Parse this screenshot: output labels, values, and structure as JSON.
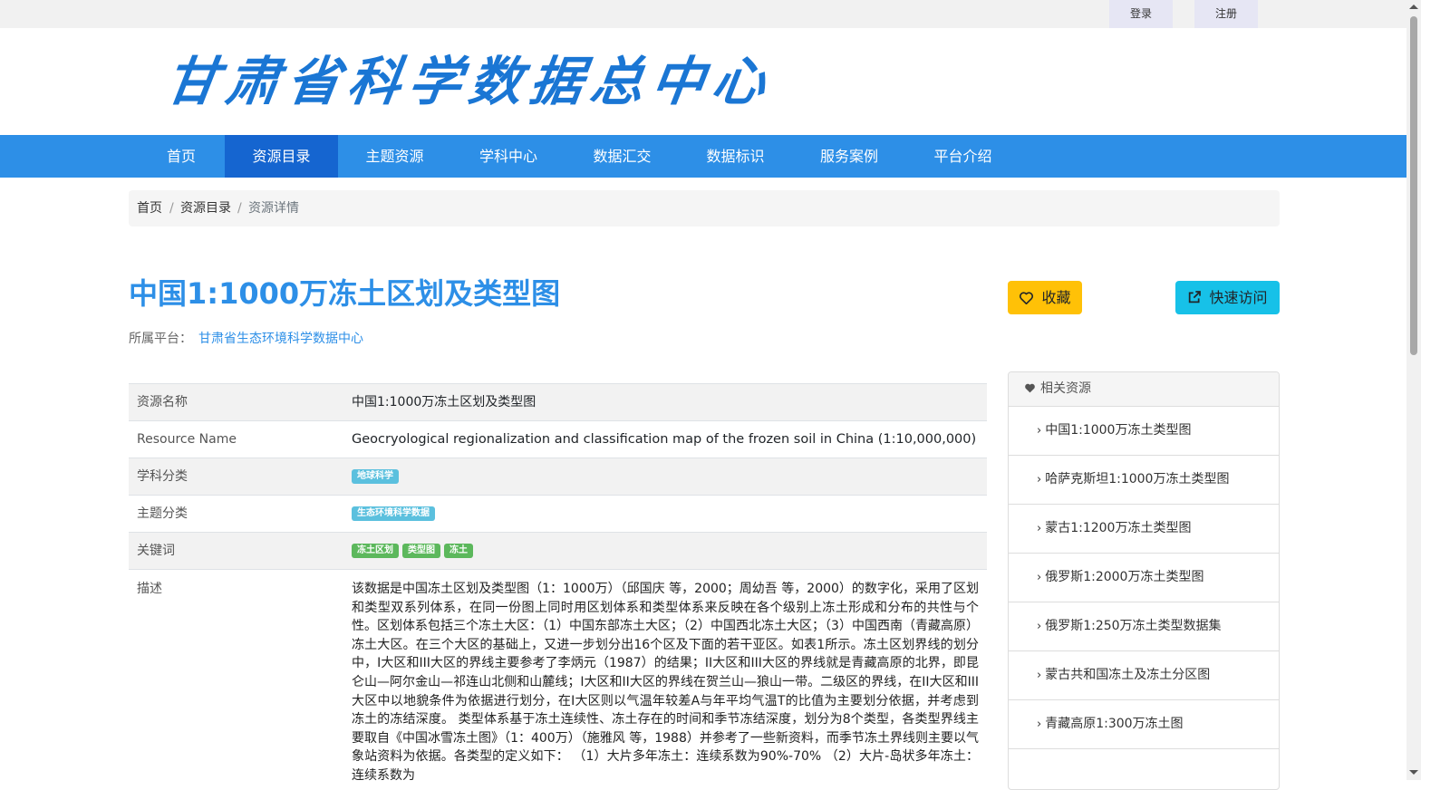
{
  "topbar": {
    "login": "登录",
    "register": "注册"
  },
  "logo": {
    "text": "甘肃省科学数据总中心"
  },
  "nav": {
    "items": [
      {
        "label": "首页"
      },
      {
        "label": "资源目录"
      },
      {
        "label": "主题资源"
      },
      {
        "label": "学科中心"
      },
      {
        "label": "数据汇交"
      },
      {
        "label": "数据标识"
      },
      {
        "label": "服务案例"
      },
      {
        "label": "平台介绍"
      }
    ],
    "active_label": "资源目录"
  },
  "breadcrumb": {
    "home": "首页",
    "sep": "/",
    "catalog": "资源目录",
    "current": "资源详情"
  },
  "resource": {
    "title": "中国1:1000万冻土区划及类型图",
    "platform_label": "所属平台：",
    "platform_name": "甘肃省生态环境科学数据中心",
    "favorite_label": "收藏",
    "visit_label": "快速访问"
  },
  "details": {
    "name_label": "资源名称",
    "name_value": "中国1:1000万冻土区划及类型图",
    "en_label": "Resource Name",
    "en_value": "Geocryological regionalization and classification map of the frozen soil in China (1:10,000,000)",
    "subject_label": "学科分类",
    "subject_tags": [
      "地球科学"
    ],
    "theme_label": "主题分类",
    "theme_tags": [
      "生态环境科学数据"
    ],
    "keywords_label": "关键词",
    "keyword_tags": [
      "冻土区划",
      "类型图",
      "冻土"
    ],
    "desc_label": "描述",
    "desc_value": "该数据是中国冻土区划及类型图（1：1000万）（邱国庆 等，2000；周幼吾 等，2000）的数字化，采用了区划和类型双系列体系，在同一份图上同时用区划体系和类型体系来反映在各个级别上冻土形成和分布的共性与个性。区划体系包括三个冻土大区：（1）中国东部冻土大区；（2）中国西北冻土大区；（3）中国西南（青藏高原）冻土大区。在三个大区的基础上，又进一步划分出16个区及下面的若干亚区。如表1所示。冻土区划界线的划分中，I大区和III大区的界线主要参考了李炳元（1987）的结果；II大区和III大区的界线就是青藏高原的北界，即昆仑山—阿尔金山—祁连山北侧和山麓线；I大区和II大区的界线在贺兰山—狼山一带。二级区的界线，在II大区和III大区中以地貌条件为依据进行划分，在I大区则以气温年较差A与年平均气温T的比值为主要划分依据，并考虑到冻土的冻结深度。 类型体系基于冻土连续性、冻土存在的时间和季节冻结深度，划分为8个类型，各类型界线主要取自《中国冰雪冻土图》（1：400万）（施雅风 等，1988）并参考了一些新资料，而季节冻土界线则主要以气象站资料为依据。各类型的定义如下： （1）大片多年冻土：连续系数为90%-70% （2）大片-岛状多年冻土：连续系数为"
  },
  "related": {
    "heading": "相关资源",
    "items": [
      "中国1:1000万冻土类型图",
      "哈萨克斯坦1:1000万冻土类型图",
      "蒙古1:1200万冻土类型图",
      "俄罗斯1:2000万冻土类型图",
      "俄罗斯1:250万冻土类型数据集",
      "蒙古共和国冻土及冻土分区图",
      "青藏高原1:300万冻土图"
    ]
  }
}
